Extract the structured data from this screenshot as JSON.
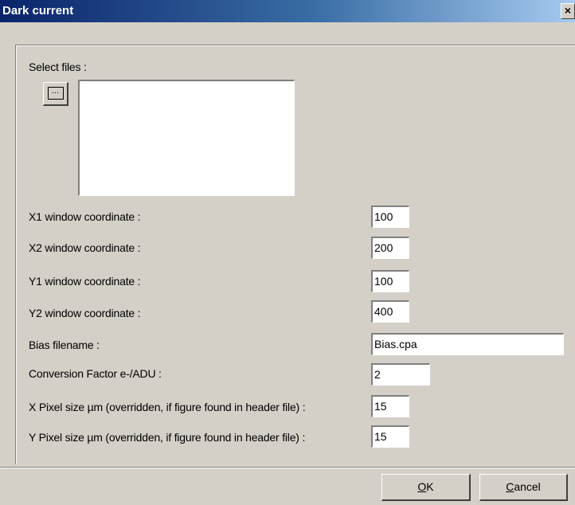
{
  "window": {
    "title": "Dark current",
    "close_glyph": "×"
  },
  "select_files": {
    "label": "Select files :",
    "browse_label": "...",
    "browse_icon": "ellipsis-icon"
  },
  "fields": [
    {
      "label": "X1 window coordinate :",
      "value": "100"
    },
    {
      "label": "X2 window coordinate :",
      "value": "200"
    },
    {
      "label": "Y1 window coordinate :",
      "value": "100"
    },
    {
      "label": "Y2 window coordinate :",
      "value": "400"
    },
    {
      "label": "Bias filename :",
      "value": "Bias.cpa"
    },
    {
      "label": "Conversion Factor e-/ADU :",
      "value": "2"
    },
    {
      "label": "X Pixel size µm (overridden, if figure found in header file) :",
      "value": "15"
    },
    {
      "label": "Y Pixel size µm (overridden, if figure found in header file) :",
      "value": "15"
    }
  ],
  "buttons": {
    "ok": {
      "accel": "O",
      "rest": "K"
    },
    "cancel": {
      "accel": "C",
      "rest": "ancel"
    }
  }
}
